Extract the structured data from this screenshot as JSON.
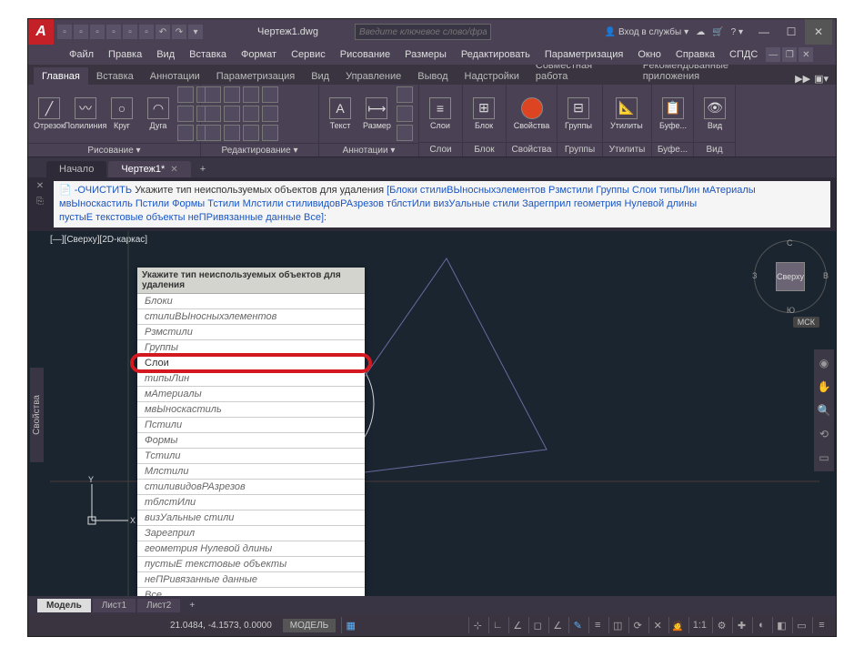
{
  "title": "Чертеж1.dwg",
  "search_placeholder": "Введите ключевое слово/фразу",
  "login_label": "Вход в службы",
  "menubar": [
    "Файл",
    "Правка",
    "Вид",
    "Вставка",
    "Формат",
    "Сервис",
    "Рисование",
    "Размеры",
    "Редактировать",
    "Параметризация",
    "Окно",
    "Справка",
    "СПДС"
  ],
  "ribbon_tabs": [
    "Главная",
    "Вставка",
    "Аннотации",
    "Параметризация",
    "Вид",
    "Управление",
    "Вывод",
    "Надстройки",
    "Совместная работа",
    "Рекомендованные приложения"
  ],
  "active_ribbon_tab": 0,
  "panels": {
    "draw": {
      "title": "Рисование ▾",
      "btns": [
        "Отрезок",
        "Полилиния",
        "Круг",
        "Дуга"
      ]
    },
    "modify": {
      "title": "Редактирование ▾"
    },
    "annot": {
      "title": "Аннотации ▾",
      "btns": [
        "Текст",
        "Размер"
      ]
    },
    "layers": {
      "title": "Слои",
      "btn": "Слои"
    },
    "block": {
      "title": "Блок",
      "btn": "Блок"
    },
    "props": {
      "title": "Свойства",
      "btn": "Свойства"
    },
    "groups": {
      "title": "Группы",
      "btn": "Группы"
    },
    "utils": {
      "title": "Утилиты",
      "btn": "Утилиты"
    },
    "clip": {
      "title": "Буфе...",
      "btn": "Буфе..."
    },
    "view": {
      "title": "Вид",
      "btn": "Вид"
    }
  },
  "file_tabs": [
    {
      "label": "Начало",
      "active": false
    },
    {
      "label": "Чертеж1*",
      "active": true
    }
  ],
  "cmdline": {
    "prefix": "-ОЧИСТИТЬ",
    "prompt": "Укажите тип неиспользуемых объектов для удаления",
    "opts_line1": "[Блоки стилиВЫносныхэлементов Рзмстили Группы Слои типыЛин мАтериалы",
    "opts_line2": "мвЫноскастиль Пстили Формы Тстили Млстили стиливидовРАзрезов тблстИли визУальные стили Зарегприл геометрия Нулевой длины",
    "opts_line3": "пустыЕ текстовые объекты неПРивязанные данные Все]:"
  },
  "vp_label": "[—][Сверху][2D-каркас]",
  "side_tab": "Свойства",
  "viewcube": {
    "top": "Сверху",
    "n": "С",
    "s": "Ю",
    "e": "В",
    "w": "З",
    "mcs": "МСК"
  },
  "options": {
    "header": "Укажите тип неиспользуемых объектов для удаления",
    "items": [
      "Блоки",
      "стилиВЫносныхэлементов",
      "Рзмстили",
      "Группы",
      "Слои",
      "типыЛин",
      "мАтериалы",
      "мвЫноскастиль",
      "Пстили",
      "Формы",
      "Тстили",
      "Млстили",
      "стиливидовРАзрезов",
      "тблстИли",
      "визУальные стили",
      "Зарегприл",
      "геометрия Нулевой длины",
      "пустыЕ текстовые объекты",
      "неПРивязанные данные",
      "Все"
    ],
    "highlighted": 4
  },
  "model_tabs": [
    "Модель",
    "Лист1",
    "Лист2"
  ],
  "active_model_tab": 0,
  "status": {
    "coords": "21.0484, -4.1573, 0.0000",
    "space": "МОДЕЛЬ",
    "scale": "1:1"
  }
}
